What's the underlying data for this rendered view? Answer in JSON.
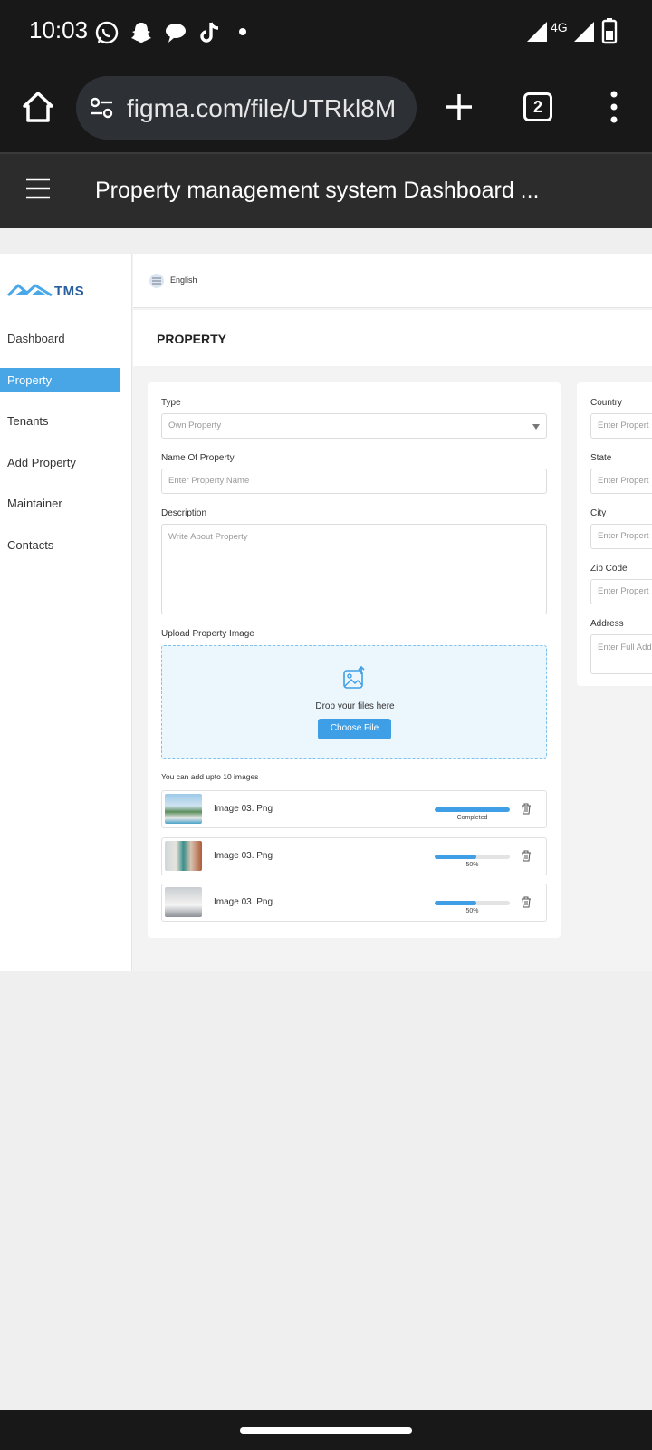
{
  "status_bar": {
    "time": "10:03",
    "notification_icons": [
      "whatsapp-icon",
      "snapchat-icon",
      "chat-icon",
      "tiktok-icon",
      "dot-icon"
    ],
    "network_label": "4G"
  },
  "browser": {
    "url": "figma.com/file/UTRkl8M",
    "tab_count": "2"
  },
  "figma": {
    "file_title": "Property management system Dashboard ..."
  },
  "app": {
    "logo_text": "TMS",
    "language": "English",
    "page_title": "PROPERTY",
    "nav": [
      {
        "label": "Dashboard",
        "active": false
      },
      {
        "label": "Property",
        "active": true
      },
      {
        "label": "Tenants",
        "active": false
      },
      {
        "label": "Add Property",
        "active": false
      },
      {
        "label": "Maintainer",
        "active": false
      },
      {
        "label": "Contacts",
        "active": false
      }
    ]
  },
  "form": {
    "type_label": "Type",
    "type_value": "Own Property",
    "name_label": "Name Of Property",
    "name_placeholder": "Enter Property Name",
    "description_label": "Description",
    "description_placeholder": "Write About Property",
    "upload_label": "Upload Property Image",
    "drop_text": "Drop your files here",
    "choose_button": "Choose File",
    "limit_text": "You can add  upto 10  images",
    "images": [
      {
        "name": "Image 03. Png",
        "progress": 1.0,
        "status": "Completed"
      },
      {
        "name": "Image 03. Png",
        "progress": 0.5,
        "status": "50%"
      },
      {
        "name": "Image 03. Png",
        "progress": 0.5,
        "status": "50%"
      }
    ]
  },
  "location_form": {
    "country_label": "Country",
    "country_placeholder": "Enter Propert",
    "state_label": "State",
    "state_placeholder": "Enter Propert",
    "city_label": "City",
    "city_placeholder": "Enter Propert",
    "zip_label": "Zip Code",
    "zip_placeholder": "Enter Propert",
    "address_label": "Address",
    "address_placeholder": "Enter Full Add"
  },
  "colors": {
    "accent": "#3E9FE6",
    "nav_active": "#48A6E7",
    "upload_bg": "#ECF6FD",
    "browser_dark": "#181818",
    "figma_header": "#2C2C2C"
  }
}
